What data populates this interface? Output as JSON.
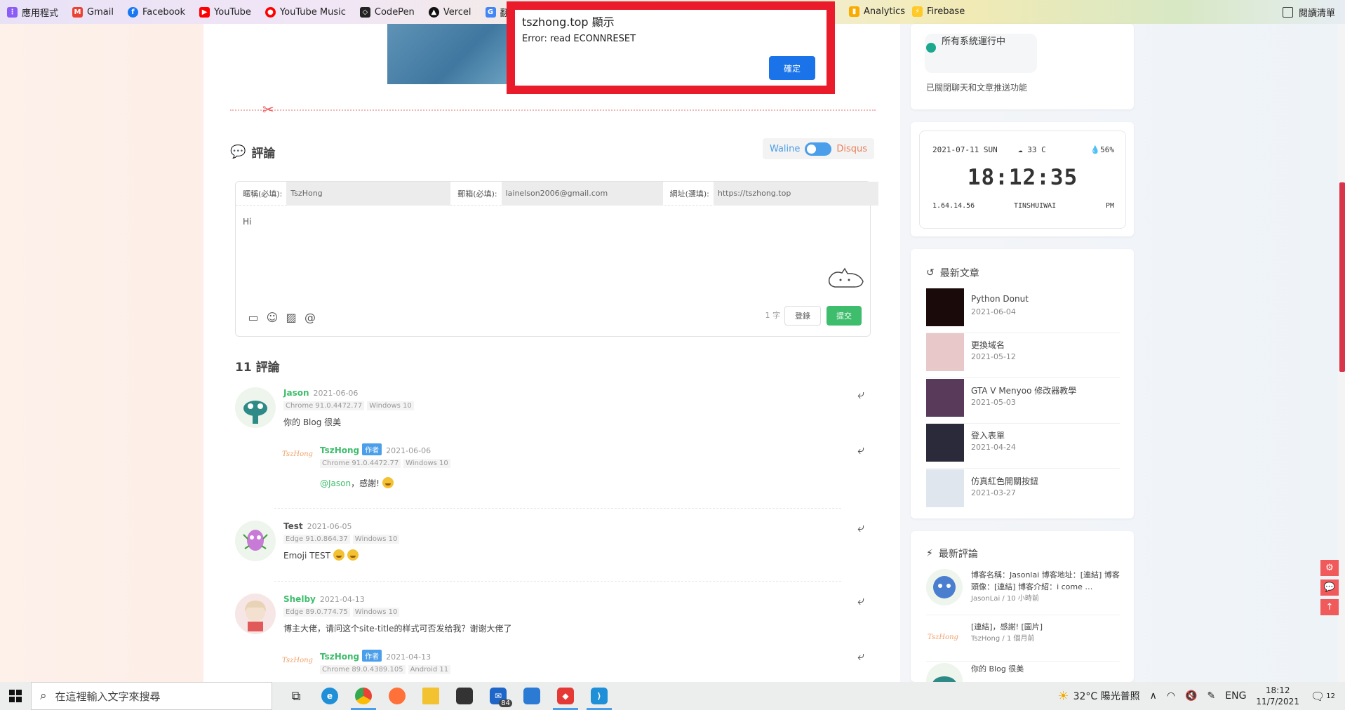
{
  "bookmarks": [
    {
      "label": "應用程式",
      "color": "#8b5cf6",
      "icon": "apps-grid-icon"
    },
    {
      "label": "Gmail",
      "color": "#ea4335",
      "icon": "gmail-icon"
    },
    {
      "label": "Facebook",
      "color": "#1877f2",
      "icon": "facebook-icon"
    },
    {
      "label": "YouTube",
      "color": "#ff0000",
      "icon": "youtube-icon"
    },
    {
      "label": "YouTube Music",
      "color": "#ff0000",
      "icon": "youtube-music-icon"
    },
    {
      "label": "CodePen",
      "color": "#222222",
      "icon": "codepen-icon"
    },
    {
      "label": "Vercel",
      "color": "#111111",
      "icon": "vercel-icon"
    },
    {
      "label": "翻譯",
      "color": "#4285f4",
      "icon": "translate-icon"
    }
  ],
  "bookmarks_right": [
    {
      "label": "Analytics",
      "color": "#f9ab00",
      "icon": "analytics-icon"
    },
    {
      "label": "Firebase",
      "color": "#ffca28",
      "icon": "firebase-icon"
    }
  ],
  "reading_list": "閱讀清單",
  "alert": {
    "title": "tszhong.top 顯示",
    "message": "Error: read ECONNRESET",
    "ok": "確定"
  },
  "comments_section": {
    "title": "評論",
    "switch_waline": "Waline",
    "switch_disqus": "Disqus",
    "fields": [
      {
        "label": "暱稱(必填):",
        "value": "TszHong"
      },
      {
        "label": "郵箱(必填):",
        "value": "lainelson2006@gmail.com"
      },
      {
        "label": "網址(選填):",
        "value": "https://tszhong.top"
      }
    ],
    "textarea": "Hi",
    "word_count": "1 字",
    "login": "登錄",
    "submit": "提交",
    "count_label": "11 評論"
  },
  "comments": [
    {
      "nick": "Jason",
      "time": "2021-06-06",
      "browser": "Chrome 91.0.4472.77",
      "os": "Windows 10",
      "text": "你的 Blog 很美"
    },
    {
      "nick": "TszHong",
      "badge": "作者",
      "time": "2021-06-06",
      "browser": "Chrome 91.0.4472.77",
      "os": "Windows 10",
      "mention": "@Jason",
      "text": "，感謝!"
    },
    {
      "nick": "Test",
      "time": "2021-06-05",
      "browser": "Edge 91.0.864.37",
      "os": "Windows 10",
      "text": "Emoji TEST"
    },
    {
      "nick": "Shelby",
      "time": "2021-04-13",
      "browser": "Edge 89.0.774.75",
      "os": "Windows 10",
      "text": "博主大佬，请问这个site-title的样式可否发给我？谢谢大佬了"
    },
    {
      "nick": "TszHong",
      "badge": "作者",
      "time": "2021-04-13",
      "browser": "Chrome 89.0.4389.105",
      "os": "Android 11"
    }
  ],
  "signature": "TszHong",
  "status_card": {
    "status": "所有系統運行中",
    "note": "已關閉聊天和文章推送功能",
    "dot_color": "#1ca88e"
  },
  "clock_widget": {
    "date": "2021-07-11 SUN",
    "weather": "33 C",
    "humidity": "56%",
    "time": "18:12:35",
    "ip": "1.64.14.56",
    "location": "TINSHUIWAI",
    "ampm": "PM"
  },
  "recent_posts": {
    "title": "最新文章",
    "items": [
      {
        "title": "Python Donut",
        "date": "2021-06-04",
        "color": "#1a0a0a"
      },
      {
        "title": "更換域名",
        "date": "2021-05-12",
        "color": "#e8c8c8"
      },
      {
        "title": "GTA V Menyoo 修改器教學",
        "date": "2021-05-03",
        "color": "#5a3a5a"
      },
      {
        "title": "登入表單",
        "date": "2021-04-24",
        "color": "#2a2a3a"
      },
      {
        "title": "仿真紅色開關按鈕",
        "date": "2021-03-27",
        "color": "#dfe6ee"
      }
    ]
  },
  "recent_comments": {
    "title": "最新評論",
    "items": [
      {
        "text": "博客名稱：Jasonlai 博客地址：[連結] 博客頭像：[連結] 博客介紹：i come …",
        "meta": "JasonLai / 10 小時前"
      },
      {
        "text": "[連結]，感謝! [圖片]",
        "meta": "TszHong / 1 個月前"
      },
      {
        "text": "你的 Blog 很美",
        "meta": ""
      }
    ]
  },
  "taskbar": {
    "search_placeholder": "在這裡輸入文字來搜尋",
    "mail_badge": "84",
    "weather": "32°C 陽光普照",
    "lang": "ENG",
    "time": "18:12",
    "date": "11/7/2021",
    "notification_count": "12"
  }
}
